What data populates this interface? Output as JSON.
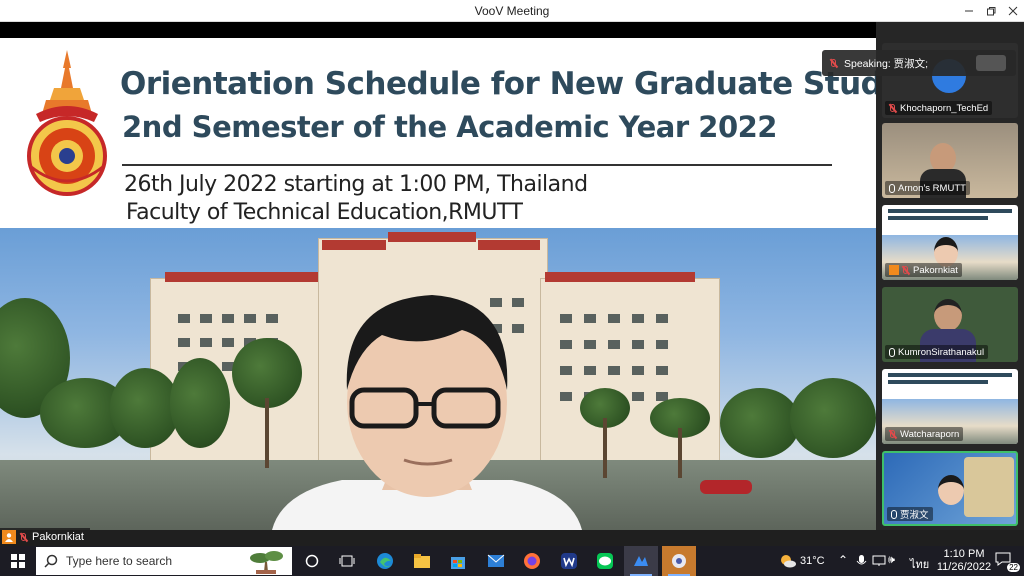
{
  "window": {
    "title": "VooV Meeting"
  },
  "slide": {
    "title_line1": "Orientation Schedule for New Graduate Students",
    "title_line2": "2nd Semester of the Academic Year 2022",
    "subtitle_line1": "26th July 2022 starting at 1:00 PM, Thailand",
    "subtitle_line2": "Faculty of Technical Education,RMUTT"
  },
  "stage": {
    "presenter_name": "Pakornkiat"
  },
  "speaking": {
    "label": "Speaking: 贾淑文;"
  },
  "participants": [
    {
      "name": "Khochaporn_TechEd",
      "mic": "muted"
    },
    {
      "name": "Arnon’s RMUTT",
      "mic": "on"
    },
    {
      "name": "Pakornkiat",
      "mic": "muted"
    },
    {
      "name": "KumronSirathanakul",
      "mic": "on"
    },
    {
      "name": "Watcharaporn",
      "mic": "muted"
    },
    {
      "name": "贾淑文",
      "mic": "on"
    }
  ],
  "taskbar": {
    "search_placeholder": "Type here to search",
    "weather": "31°C",
    "language": "ไทย",
    "time": "1:10 PM",
    "date": "11/26/2022",
    "notifications": "22"
  },
  "colors": {
    "accent": "#2e4a5c",
    "tile_active_border": "#3fbf6a",
    "taskbar": "#1c1c24"
  }
}
